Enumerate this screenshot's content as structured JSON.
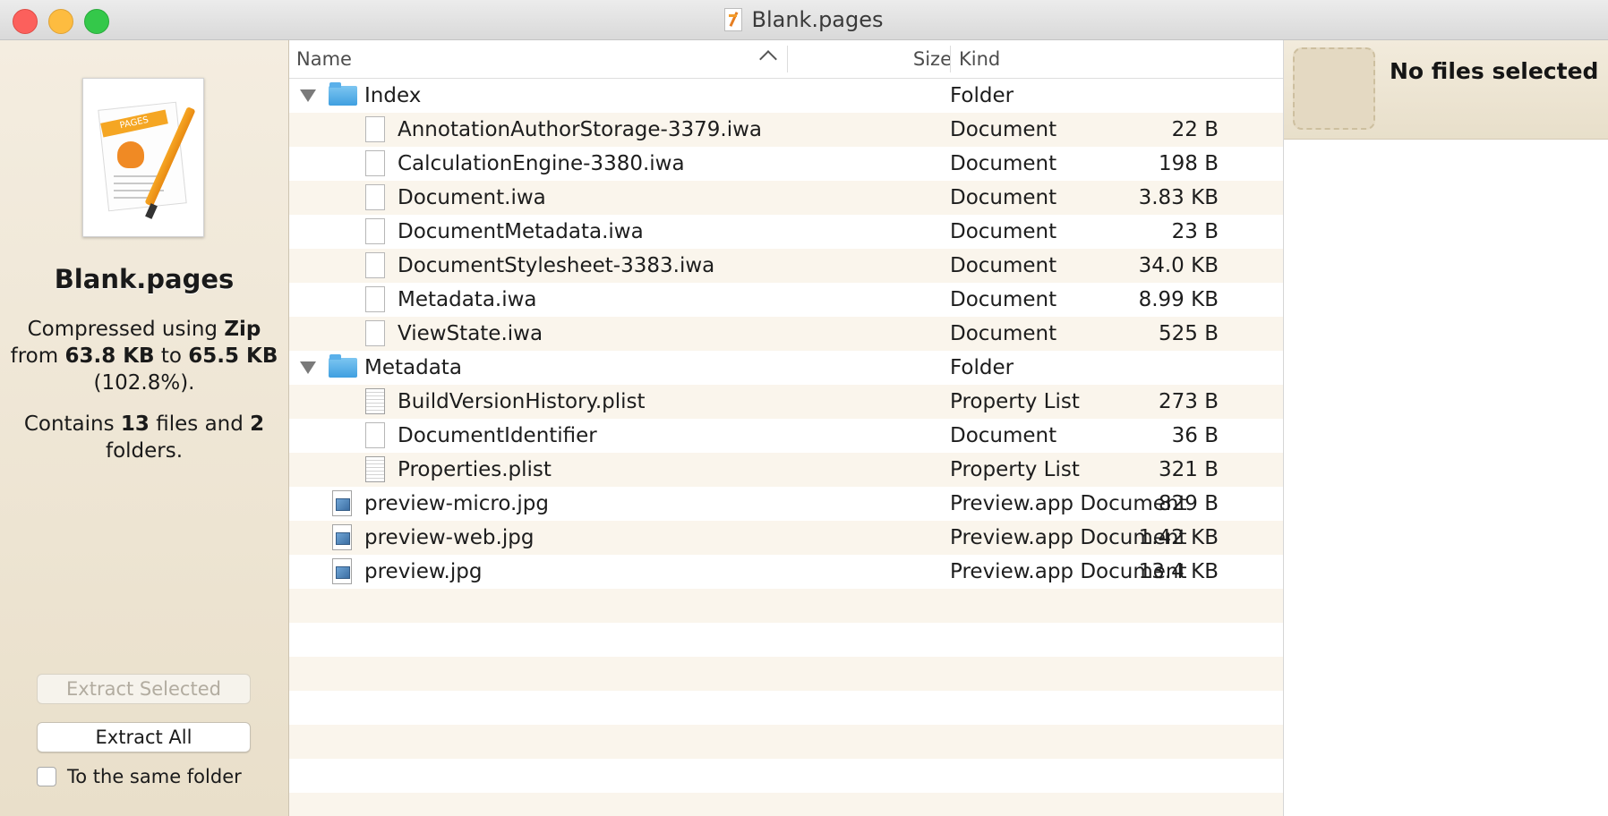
{
  "window": {
    "title": "Blank.pages"
  },
  "sidebar": {
    "file_name": "Blank.pages",
    "compression": {
      "prefix": "Compressed using ",
      "method": "Zip",
      "from_prefix": "from ",
      "from_size": "63.8 KB",
      "to_prefix": " to ",
      "to_size": "65.5 KB",
      "ratio_prefix": "(",
      "ratio": "102.8%",
      "ratio_suffix": ")."
    },
    "contents": {
      "prefix": "Contains ",
      "files": "13",
      "files_label": " files and ",
      "folders": "2",
      "folders_label_line1": "",
      "folders_label": "folders."
    },
    "extract_selected_label": "Extract Selected",
    "extract_all_label": "Extract All",
    "same_folder_label": "To the same folder",
    "same_folder_checked": false
  },
  "table": {
    "columns": {
      "name": "Name",
      "size": "Size",
      "kind": "Kind"
    },
    "rows": [
      {
        "name": "Index",
        "size": "",
        "kind": "Folder",
        "type": "folder",
        "level": 0,
        "expanded": true
      },
      {
        "name": "AnnotationAuthorStorage-3379.iwa",
        "size": "22 B",
        "kind": "Document",
        "type": "doc",
        "level": 1
      },
      {
        "name": "CalculationEngine-3380.iwa",
        "size": "198 B",
        "kind": "Document",
        "type": "doc",
        "level": 1
      },
      {
        "name": "Document.iwa",
        "size": "3.83 KB",
        "kind": "Document",
        "type": "doc",
        "level": 1
      },
      {
        "name": "DocumentMetadata.iwa",
        "size": "23 B",
        "kind": "Document",
        "type": "doc",
        "level": 1
      },
      {
        "name": "DocumentStylesheet-3383.iwa",
        "size": "34.0 KB",
        "kind": "Document",
        "type": "doc",
        "level": 1
      },
      {
        "name": "Metadata.iwa",
        "size": "8.99 KB",
        "kind": "Document",
        "type": "doc",
        "level": 1
      },
      {
        "name": "ViewState.iwa",
        "size": "525 B",
        "kind": "Document",
        "type": "doc",
        "level": 1
      },
      {
        "name": "Metadata",
        "size": "",
        "kind": "Folder",
        "type": "folder",
        "level": 0,
        "expanded": true
      },
      {
        "name": "BuildVersionHistory.plist",
        "size": "273 B",
        "kind": "Property List",
        "type": "plist",
        "level": 1
      },
      {
        "name": "DocumentIdentifier",
        "size": "36 B",
        "kind": "Document",
        "type": "doc",
        "level": 1
      },
      {
        "name": "Properties.plist",
        "size": "321 B",
        "kind": "Property List",
        "type": "plist",
        "level": 1
      },
      {
        "name": "preview-micro.jpg",
        "size": "829 B",
        "kind": "Preview.app Document",
        "type": "jpg",
        "level": 0
      },
      {
        "name": "preview-web.jpg",
        "size": "1.42 KB",
        "kind": "Preview.app Document",
        "type": "jpg",
        "level": 0
      },
      {
        "name": "preview.jpg",
        "size": "13.4 KB",
        "kind": "Preview.app Document",
        "type": "jpg",
        "level": 0
      }
    ],
    "empty_rows": 7
  },
  "inspector": {
    "status": "No files selected"
  }
}
